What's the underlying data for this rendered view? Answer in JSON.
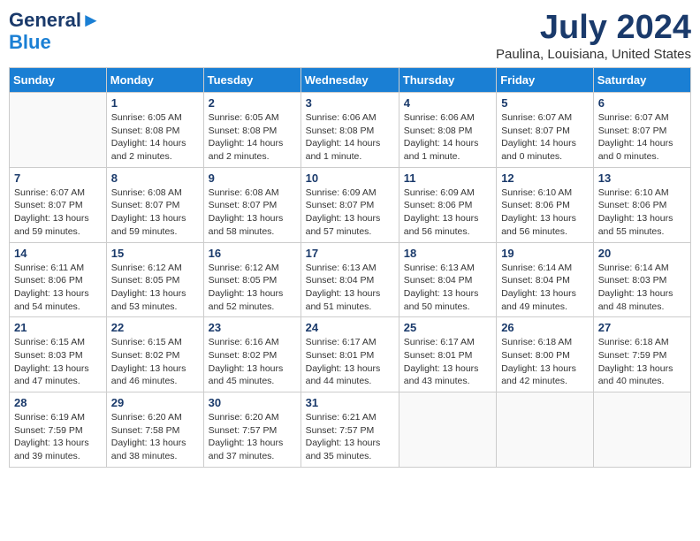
{
  "header": {
    "logo_line1": "General",
    "logo_line2": "Blue",
    "title": "July 2024",
    "subtitle": "Paulina, Louisiana, United States"
  },
  "days_of_week": [
    "Sunday",
    "Monday",
    "Tuesday",
    "Wednesday",
    "Thursday",
    "Friday",
    "Saturday"
  ],
  "weeks": [
    [
      {
        "day": "",
        "info": ""
      },
      {
        "day": "1",
        "info": "Sunrise: 6:05 AM\nSunset: 8:08 PM\nDaylight: 14 hours\nand 2 minutes."
      },
      {
        "day": "2",
        "info": "Sunrise: 6:05 AM\nSunset: 8:08 PM\nDaylight: 14 hours\nand 2 minutes."
      },
      {
        "day": "3",
        "info": "Sunrise: 6:06 AM\nSunset: 8:08 PM\nDaylight: 14 hours\nand 1 minute."
      },
      {
        "day": "4",
        "info": "Sunrise: 6:06 AM\nSunset: 8:08 PM\nDaylight: 14 hours\nand 1 minute."
      },
      {
        "day": "5",
        "info": "Sunrise: 6:07 AM\nSunset: 8:07 PM\nDaylight: 14 hours\nand 0 minutes."
      },
      {
        "day": "6",
        "info": "Sunrise: 6:07 AM\nSunset: 8:07 PM\nDaylight: 14 hours\nand 0 minutes."
      }
    ],
    [
      {
        "day": "7",
        "info": ""
      },
      {
        "day": "8",
        "info": "Sunrise: 6:08 AM\nSunset: 8:07 PM\nDaylight: 13 hours\nand 59 minutes."
      },
      {
        "day": "9",
        "info": "Sunrise: 6:08 AM\nSunset: 8:07 PM\nDaylight: 13 hours\nand 58 minutes."
      },
      {
        "day": "10",
        "info": "Sunrise: 6:09 AM\nSunset: 8:07 PM\nDaylight: 13 hours\nand 57 minutes."
      },
      {
        "day": "11",
        "info": "Sunrise: 6:09 AM\nSunset: 8:06 PM\nDaylight: 13 hours\nand 56 minutes."
      },
      {
        "day": "12",
        "info": "Sunrise: 6:10 AM\nSunset: 8:06 PM\nDaylight: 13 hours\nand 56 minutes."
      },
      {
        "day": "13",
        "info": "Sunrise: 6:10 AM\nSunset: 8:06 PM\nDaylight: 13 hours\nand 55 minutes."
      }
    ],
    [
      {
        "day": "14",
        "info": ""
      },
      {
        "day": "15",
        "info": "Sunrise: 6:12 AM\nSunset: 8:05 PM\nDaylight: 13 hours\nand 53 minutes."
      },
      {
        "day": "16",
        "info": "Sunrise: 6:12 AM\nSunset: 8:05 PM\nDaylight: 13 hours\nand 52 minutes."
      },
      {
        "day": "17",
        "info": "Sunrise: 6:13 AM\nSunset: 8:04 PM\nDaylight: 13 hours\nand 51 minutes."
      },
      {
        "day": "18",
        "info": "Sunrise: 6:13 AM\nSunset: 8:04 PM\nDaylight: 13 hours\nand 50 minutes."
      },
      {
        "day": "19",
        "info": "Sunrise: 6:14 AM\nSunset: 8:04 PM\nDaylight: 13 hours\nand 49 minutes."
      },
      {
        "day": "20",
        "info": "Sunrise: 6:14 AM\nSunset: 8:03 PM\nDaylight: 13 hours\nand 48 minutes."
      }
    ],
    [
      {
        "day": "21",
        "info": ""
      },
      {
        "day": "22",
        "info": "Sunrise: 6:15 AM\nSunset: 8:02 PM\nDaylight: 13 hours\nand 46 minutes."
      },
      {
        "day": "23",
        "info": "Sunrise: 6:16 AM\nSunset: 8:02 PM\nDaylight: 13 hours\nand 45 minutes."
      },
      {
        "day": "24",
        "info": "Sunrise: 6:17 AM\nSunset: 8:01 PM\nDaylight: 13 hours\nand 44 minutes."
      },
      {
        "day": "25",
        "info": "Sunrise: 6:17 AM\nSunset: 8:01 PM\nDaylight: 13 hours\nand 43 minutes."
      },
      {
        "day": "26",
        "info": "Sunrise: 6:18 AM\nSunset: 8:00 PM\nDaylight: 13 hours\nand 42 minutes."
      },
      {
        "day": "27",
        "info": "Sunrise: 6:18 AM\nSunset: 7:59 PM\nDaylight: 13 hours\nand 40 minutes."
      }
    ],
    [
      {
        "day": "28",
        "info": "Sunrise: 6:19 AM\nSunset: 7:59 PM\nDaylight: 13 hours\nand 39 minutes."
      },
      {
        "day": "29",
        "info": "Sunrise: 6:20 AM\nSunset: 7:58 PM\nDaylight: 13 hours\nand 38 minutes."
      },
      {
        "day": "30",
        "info": "Sunrise: 6:20 AM\nSunset: 7:57 PM\nDaylight: 13 hours\nand 37 minutes."
      },
      {
        "day": "31",
        "info": "Sunrise: 6:21 AM\nSunset: 7:57 PM\nDaylight: 13 hours\nand 35 minutes."
      },
      {
        "day": "",
        "info": ""
      },
      {
        "day": "",
        "info": ""
      },
      {
        "day": "",
        "info": ""
      }
    ]
  ],
  "week7_sunday": "Sunrise: 6:07 AM\nSunset: 8:07 PM\nDaylight: 13 hours\nand 59 minutes.",
  "week14_sunday": "Sunrise: 6:11 AM\nSunset: 8:06 PM\nDaylight: 13 hours\nand 54 minutes.",
  "week21_sunday": "Sunrise: 6:15 AM\nSunset: 8:03 PM\nDaylight: 13 hours\nand 47 minutes."
}
